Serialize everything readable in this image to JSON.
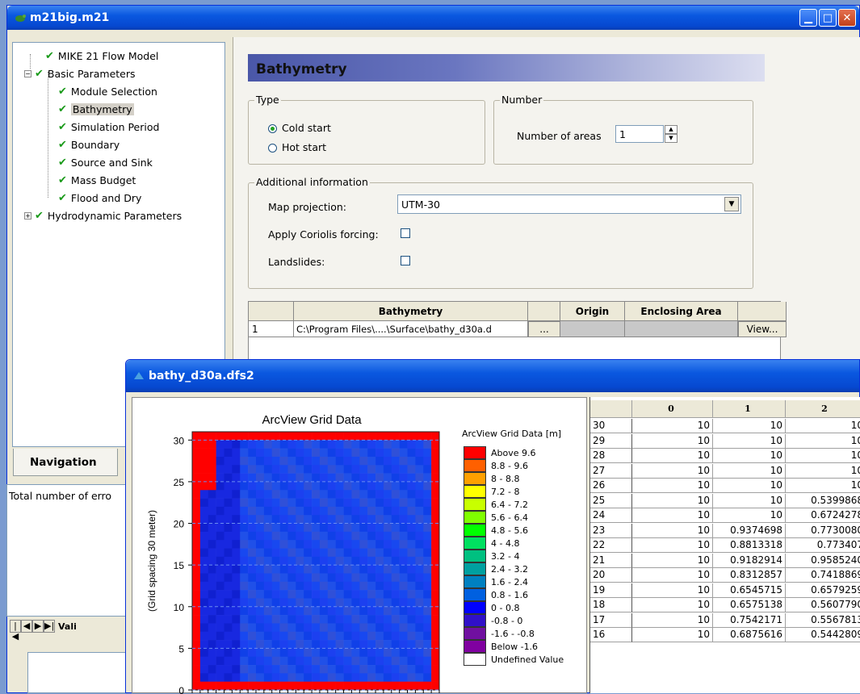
{
  "main_window": {
    "title": "m21big.m21",
    "controls": {
      "minimize": "▁",
      "maximize": "□",
      "close": "✕"
    }
  },
  "tree": {
    "items": [
      {
        "label": "MIKE 21 Flow Model",
        "level": 1
      },
      {
        "label": "Basic Parameters",
        "level": 0,
        "expander": "−"
      },
      {
        "label": "Module Selection",
        "level": 2
      },
      {
        "label": "Bathymetry",
        "level": 2,
        "selected": true
      },
      {
        "label": "Simulation Period",
        "level": 2
      },
      {
        "label": "Boundary",
        "level": 2
      },
      {
        "label": "Source and Sink",
        "level": 2
      },
      {
        "label": "Mass Budget",
        "level": 2
      },
      {
        "label": "Flood and Dry",
        "level": 2
      },
      {
        "label": "Hydrodynamic Parameters",
        "level": 0,
        "expander": "+"
      }
    ]
  },
  "left_tabs": {
    "navigation": "Navigation",
    "errors_text": "Total number of erro",
    "validation_tab": "Vali"
  },
  "bathymetry": {
    "header": "Bathymetry",
    "type_group": "Type",
    "cold_start": "Cold start",
    "hot_start": "Hot start",
    "number_group": "Number",
    "number_of_areas_label": "Number of areas",
    "number_of_areas_value": "1",
    "additional_group": "Additional information",
    "map_projection_label": "Map projection:",
    "map_projection_value": "UTM-30",
    "coriolis_label": "Apply Coriolis forcing:",
    "landslides_label": "Landslides:",
    "grid": {
      "headers": [
        "",
        "Bathymetry",
        "",
        "Origin",
        "Enclosing Area",
        ""
      ],
      "row": {
        "index": "1",
        "path": "C:\\Program Files\\....\\Surface\\bathy_d30a.d",
        "browse": "...",
        "view": "View..."
      }
    }
  },
  "child_window": {
    "title": "bathy_d30a.dfs2"
  },
  "chart_data": {
    "type": "heatmap",
    "title": "ArcView Grid Data",
    "xlabel": "",
    "ylabel": "(Grid spacing 30 meter)",
    "ylim": [
      0,
      31
    ],
    "yticks": [
      "0",
      "5",
      "10",
      "15",
      "20",
      "25",
      "30"
    ],
    "legend_title": "ArcView Grid Data [m]",
    "legend": [
      {
        "label": "Above 9.6",
        "color": "#ff0000"
      },
      {
        "label": "8.8 - 9.6",
        "color": "#ff6000"
      },
      {
        "label": "8 - 8.8",
        "color": "#ffa000"
      },
      {
        "label": "7.2 - 8",
        "color": "#ffff00"
      },
      {
        "label": "6.4 - 7.2",
        "color": "#c8ff00"
      },
      {
        "label": "5.6 - 6.4",
        "color": "#80ff00"
      },
      {
        "label": "4.8 - 5.6",
        "color": "#00ff00"
      },
      {
        "label": "4 - 4.8",
        "color": "#00e060"
      },
      {
        "label": "3.2 - 4",
        "color": "#00c080"
      },
      {
        "label": "2.4 - 3.2",
        "color": "#00a0a0"
      },
      {
        "label": "1.6 - 2.4",
        "color": "#0080c0"
      },
      {
        "label": "0.8 - 1.6",
        "color": "#0060e0"
      },
      {
        "label": "0 - 0.8",
        "color": "#0000ff"
      },
      {
        "label": "-0.8 - 0",
        "color": "#3010c8"
      },
      {
        "label": "-1.6 - -0.8",
        "color": "#7010a0"
      },
      {
        "label": "Below -1.6",
        "color": "#8000a0"
      },
      {
        "label": "Undefined Value",
        "color": "#ffffff"
      }
    ]
  },
  "data_table": {
    "columns": [
      "",
      "0",
      "1",
      "2"
    ],
    "rows": [
      [
        "30",
        "10",
        "10",
        "10"
      ],
      [
        "29",
        "10",
        "10",
        "10"
      ],
      [
        "28",
        "10",
        "10",
        "10"
      ],
      [
        "27",
        "10",
        "10",
        "10"
      ],
      [
        "26",
        "10",
        "10",
        "10"
      ],
      [
        "25",
        "10",
        "10",
        "0.5399868"
      ],
      [
        "24",
        "10",
        "10",
        "0.6724278"
      ],
      [
        "23",
        "10",
        "0.9374698",
        "0.7730080"
      ],
      [
        "22",
        "10",
        "0.8813318",
        "0.773407"
      ],
      [
        "21",
        "10",
        "0.9182914",
        "0.9585240"
      ],
      [
        "20",
        "10",
        "0.8312857",
        "0.7418869"
      ],
      [
        "19",
        "10",
        "0.6545715",
        "0.6579259"
      ],
      [
        "18",
        "10",
        "0.6575138",
        "0.5607790"
      ],
      [
        "17",
        "10",
        "0.7542171",
        "0.5567813"
      ],
      [
        "16",
        "10",
        "0.6875616",
        "0.5442809"
      ]
    ]
  }
}
